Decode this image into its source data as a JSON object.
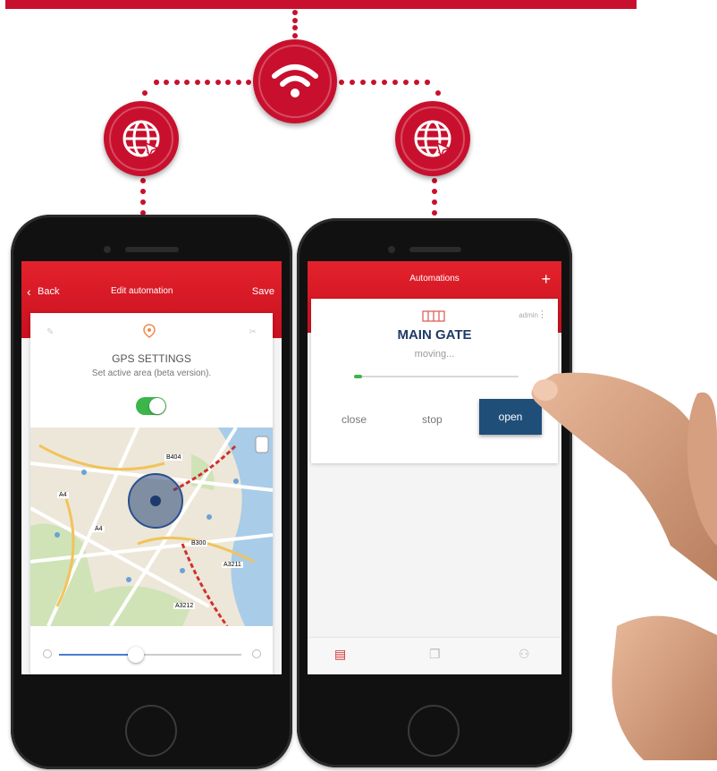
{
  "colors": {
    "brand_red": "#c8102e",
    "toggle_green": "#3cb54a",
    "open_blue": "#1f4e79",
    "slider_blue": "#4a7bd0"
  },
  "icons": {
    "router": "wifi-icon",
    "cloud_left": "globe-icon",
    "cloud_right": "globe-icon"
  },
  "left_phone": {
    "header": {
      "back_label": "Back",
      "title": "Edit automation",
      "save_label": "Save"
    },
    "gps_card": {
      "title": "GPS SETTINGS",
      "subtitle": "Set active area (beta version).",
      "toggle_on": true
    },
    "map_labels": [
      "B404",
      "A4",
      "B300",
      "A3211",
      "A3212",
      "A4"
    ],
    "slider_level": 0.42
  },
  "right_phone": {
    "header": {
      "title": "Automations",
      "add_label": "+"
    },
    "device_card": {
      "user_label": "admin",
      "name": "MAIN GATE",
      "status": "moving...",
      "progress": 0.05,
      "close_label": "close",
      "stop_label": "stop",
      "open_label": "open"
    }
  }
}
